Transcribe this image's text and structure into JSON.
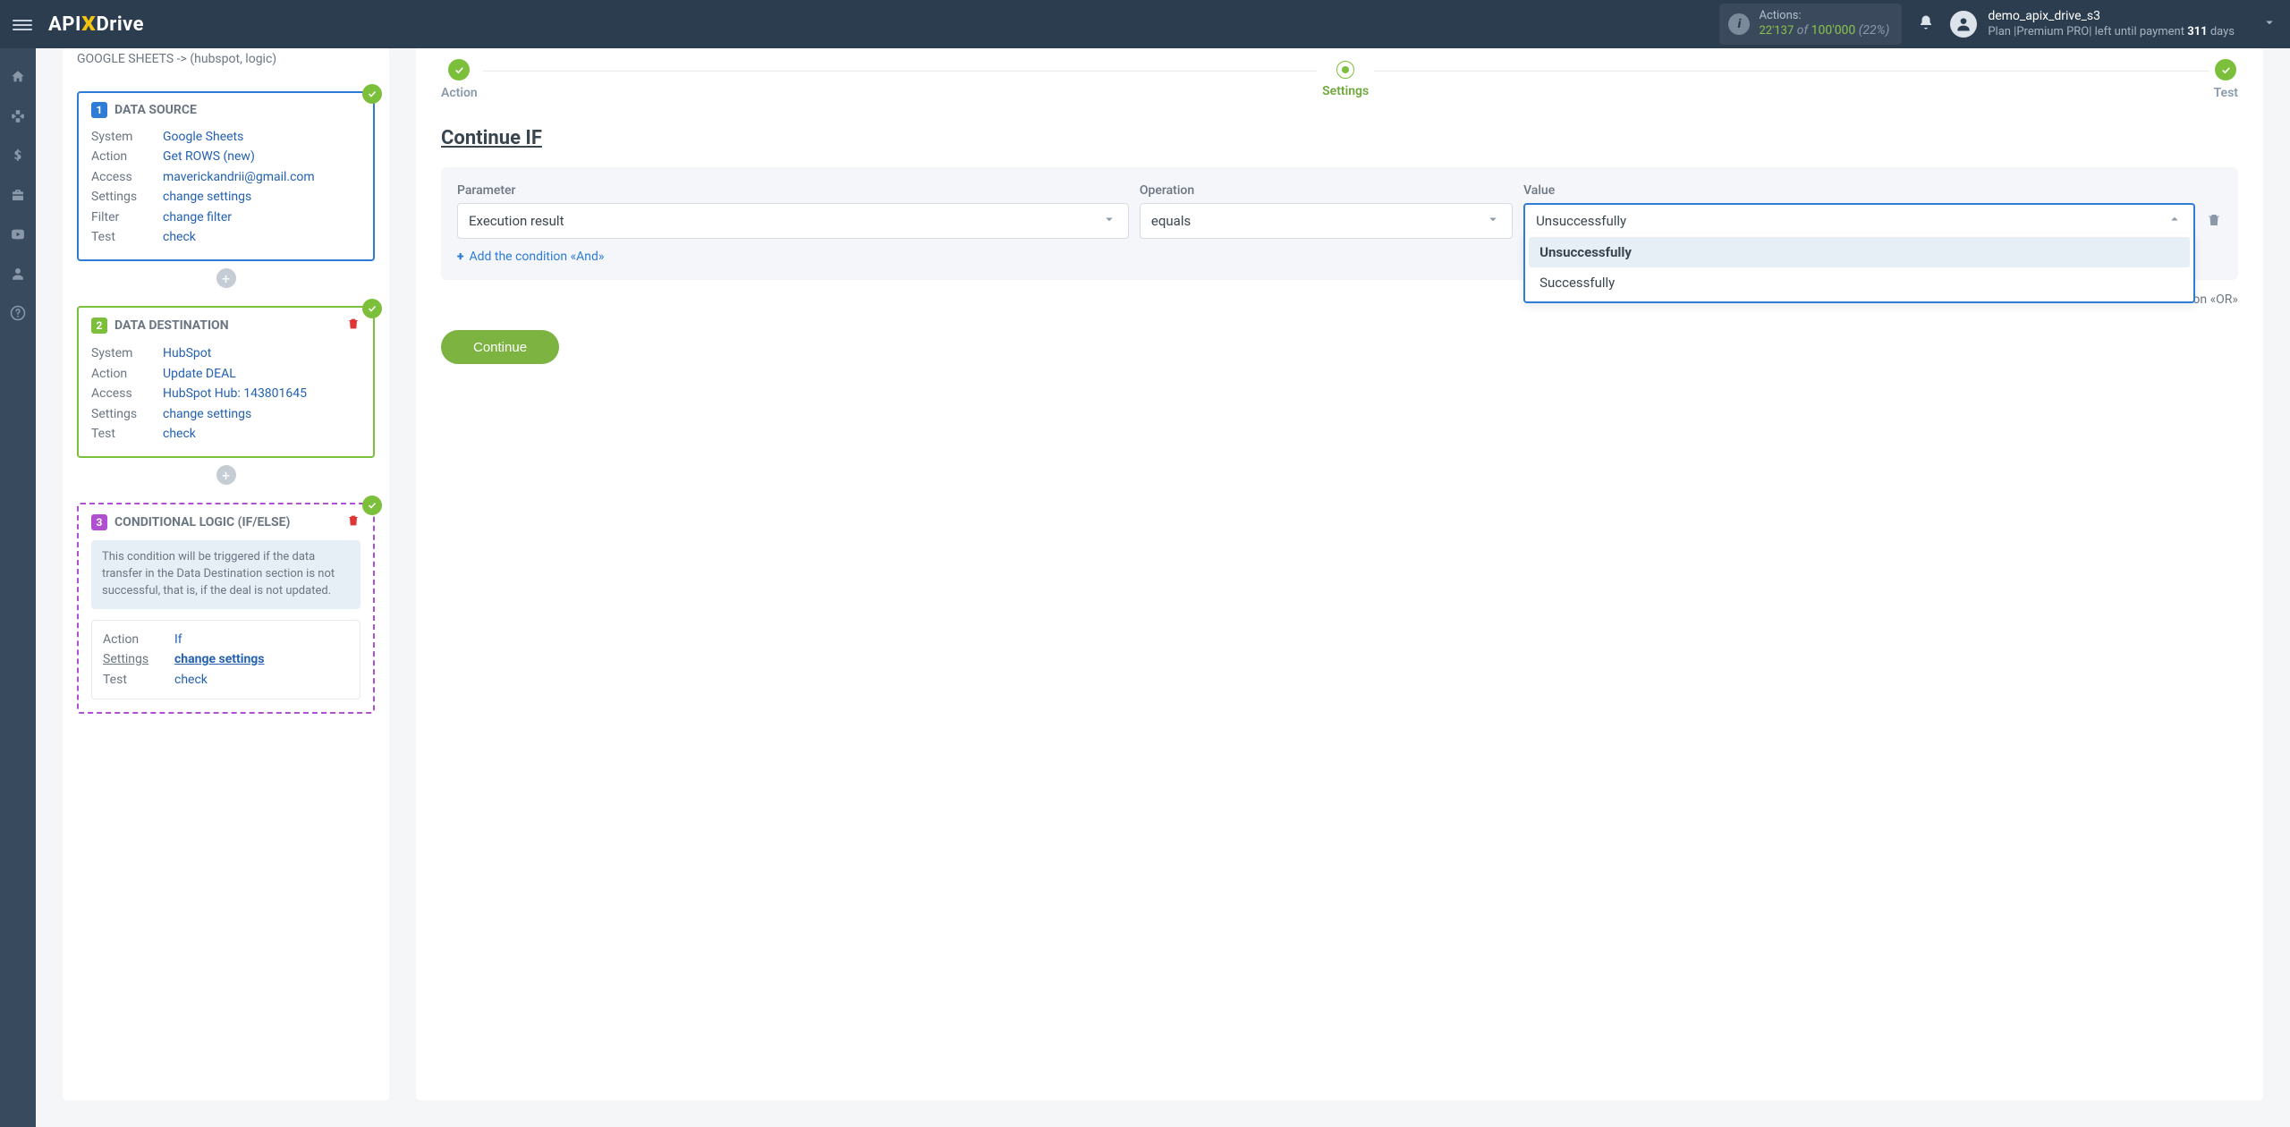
{
  "topbar": {
    "logo_parts": {
      "a": "API",
      "x": "X",
      "d": "Drive"
    },
    "actions_label": "Actions:",
    "actions_used": "22'137",
    "actions_of": " of ",
    "actions_total": "100'000",
    "actions_pct": " (22%)",
    "user_name": "demo_apix_drive_s3",
    "plan_prefix": "Plan |Premium PRO| left until payment ",
    "plan_days_num": "311",
    "plan_days_suffix": " days"
  },
  "sidenav": {
    "items": [
      {
        "name": "home-icon"
      },
      {
        "name": "sitemap-icon"
      },
      {
        "name": "dollar-icon"
      },
      {
        "name": "briefcase-icon"
      },
      {
        "name": "youtube-icon"
      },
      {
        "name": "user-icon"
      },
      {
        "name": "help-icon"
      }
    ]
  },
  "breadcrumb": "GOOGLE SHEETS -> (hubspot, logic)",
  "source": {
    "title": "DATA SOURCE",
    "rows": {
      "system_k": "System",
      "system_v": "Google Sheets",
      "action_k": "Action",
      "action_v": "Get ROWS (new)",
      "access_k": "Access",
      "access_v": "maverickandrii@gmail.com",
      "settings_k": "Settings",
      "settings_v": "change settings",
      "filter_k": "Filter",
      "filter_v": "change filter",
      "test_k": "Test",
      "test_v": "check"
    }
  },
  "dest": {
    "title": "DATA DESTINATION",
    "rows": {
      "system_k": "System",
      "system_v": "HubSpot",
      "action_k": "Action",
      "action_v": "Update DEAL",
      "access_k": "Access",
      "access_v": "HubSpot Hub: 143801645",
      "settings_k": "Settings",
      "settings_v": "change settings",
      "test_k": "Test",
      "test_v": "check"
    }
  },
  "cond": {
    "title": "CONDITIONAL LOGIC (IF/ELSE)",
    "desc": "This condition will be triggered if the data transfer in the Data Destination section is not successful, that is, if the deal is not updated.",
    "rows": {
      "action_k": "Action",
      "action_v": "If",
      "settings_k": "Settings",
      "settings_v": "change settings",
      "test_k": "Test",
      "test_v": "check"
    }
  },
  "stepper": {
    "action": "Action",
    "settings": "Settings",
    "test": "Test"
  },
  "section_title": "Continue IF",
  "form": {
    "param_label": "Parameter",
    "param_value": "Execution result",
    "op_label": "Operation",
    "op_value": "equals",
    "val_label": "Value",
    "val_value": "Unsuccessfully",
    "options": {
      "opt1": "Unsuccessfully",
      "opt2": "Successfully"
    },
    "add_and": "Add the condition «And»",
    "or_suffix": "on «OR»",
    "continue": "Continue"
  }
}
